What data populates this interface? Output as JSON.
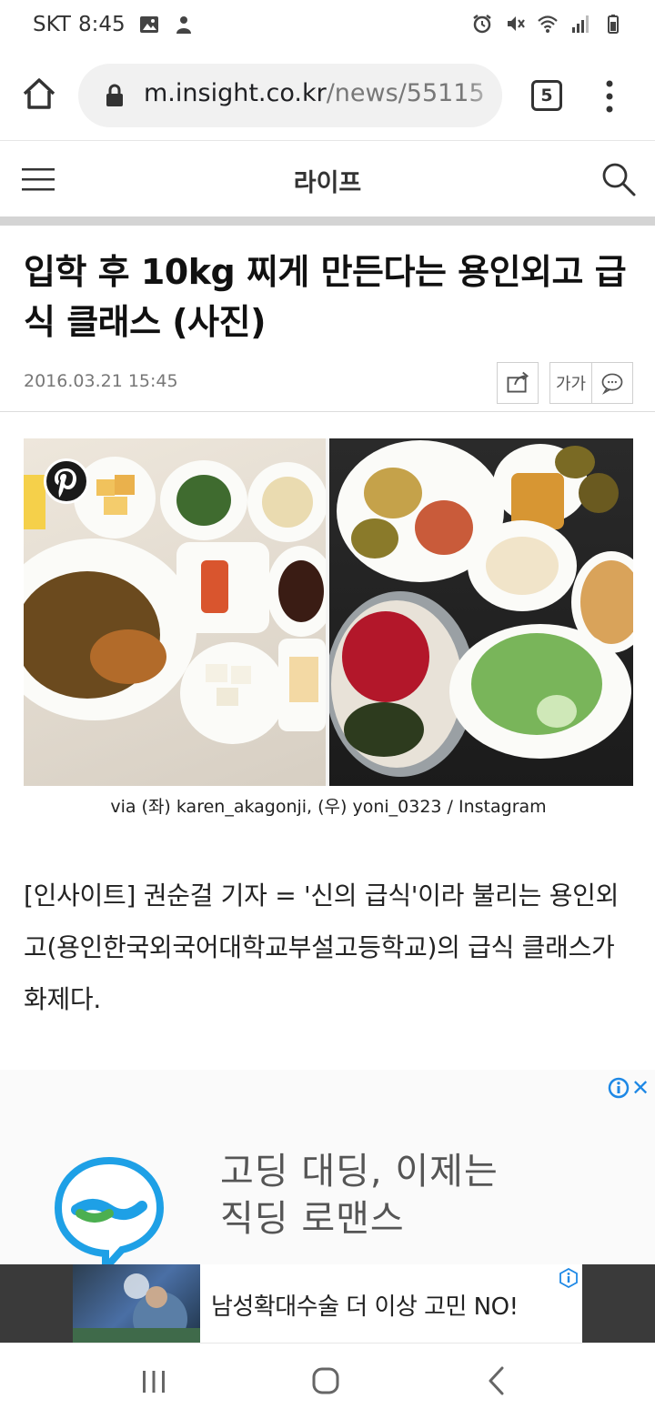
{
  "status_bar": {
    "carrier": "SKT",
    "time": "8:45",
    "icons": [
      "image-icon",
      "person-notification-icon",
      "alarm-icon",
      "mute-icon",
      "wifi-icon",
      "signal-icon",
      "battery-icon"
    ]
  },
  "browser": {
    "url_host": "m.insight.co.kr",
    "url_path": "/news/55115",
    "tab_count": "5"
  },
  "site_header": {
    "section_title": "라이프"
  },
  "article": {
    "headline": "입학 후 10kg 찌게 만든다는 용인외고 급식 클래스 (사진)",
    "date": "2016.03.21 15:45",
    "font_size_label": "가가",
    "photo_caption": "via (좌) karen_akagonji, (우) yoni_0323 / Instagram",
    "body": "[인사이트] 권순걸 기자 = '신의 급식'이라 불리는 용인외고(용인한국외국어대학교부설고등학교)의 급식 클래스가 화제다."
  },
  "ad": {
    "headline_line1": "고딩 대딩, 이제는",
    "headline_line2": "직딩 로맨스",
    "close_symbol": "✕"
  },
  "banner": {
    "text": "남성확대수술 더 이상 고민 NO!"
  },
  "colors": {
    "accent_blue": "#1e88e5",
    "divider_gray": "#d4d4d4",
    "logo_blue": "#1ea0e6",
    "logo_green": "#4caf50"
  }
}
